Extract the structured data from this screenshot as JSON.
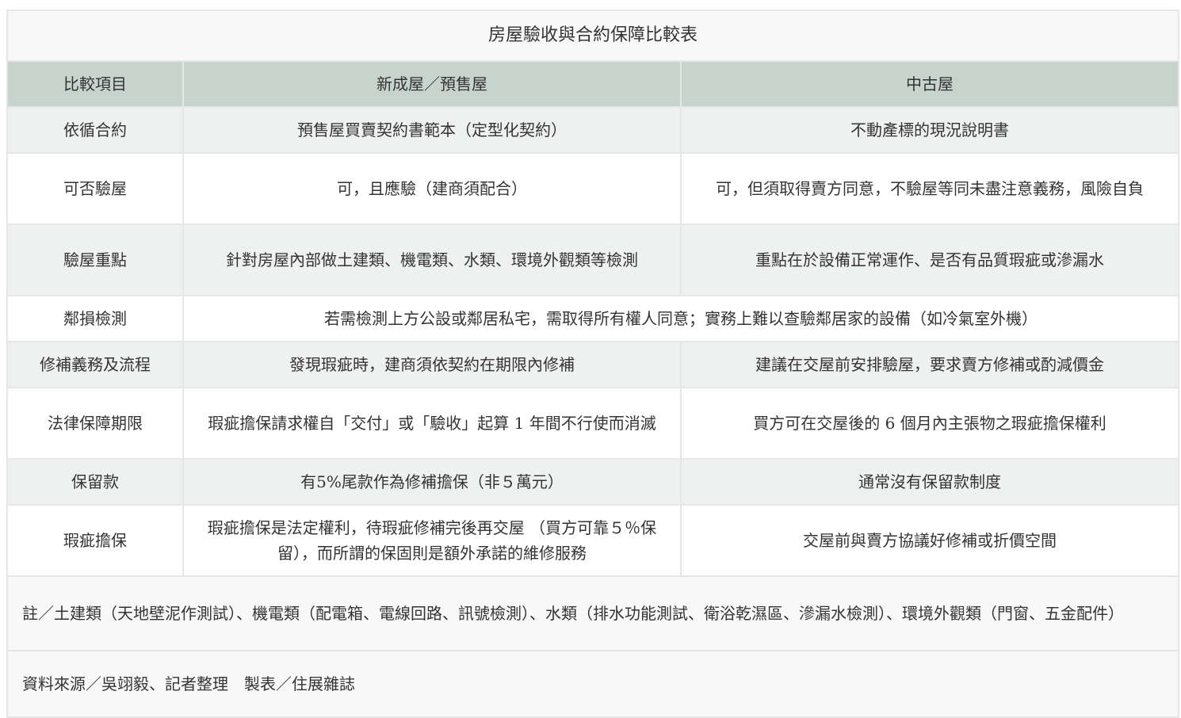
{
  "table": {
    "title": "房屋驗收與合約保障比較表",
    "headers": [
      "比較項目",
      "新成屋／預售屋",
      "中古屋"
    ],
    "rows": [
      [
        "依循合約",
        "預售屋買賣契約書範本（定型化契約）",
        "不動產標的現況說明書"
      ],
      [
        "可否驗屋",
        "可，且應驗（建商須配合）",
        "可，但須取得賣方同意，不驗屋等同未盡注意義務，風險自負"
      ],
      [
        "驗屋重點",
        "針對房屋內部做土建類、機電類、水類、環境外觀類等檢測",
        "重點在於設備正常運作、是否有品質瑕疵或滲漏水"
      ],
      [
        "鄰損檢測",
        "若需檢測上方公設或鄰居私宅，需取得所有權人同意；實務上難以查驗鄰居家的設備（如冷氣室外機）"
      ],
      [
        "修補義務及流程",
        "發現瑕疵時，建商須依契約在期限內修補",
        "建議在交屋前安排驗屋，要求賣方修補或酌減價金"
      ],
      [
        "法律保障期限",
        "瑕疵擔保請求權自「交付」或「驗收」起算 1 年間不行使而消滅",
        "買方可在交屋後的 6 個月內主張物之瑕疵擔保權利"
      ],
      [
        "保留款",
        "有5%尾款作為修補擔保（非５萬元）",
        "通常沒有保留款制度"
      ],
      [
        "瑕疵擔保",
        "瑕疵擔保是法定權利，待瑕疵修補完後再交屋 （買方可靠５％保留），而所謂的保固則是額外承諾的維修服務",
        "交屋前與賣方協議好修補或折價空間"
      ]
    ],
    "note": "註／土建類（天地壁泥作測試）、機電類（配電箱、電線回路、訊號檢測）、水類（排水功能測試、衛浴乾濕區、滲漏水檢測）、環境外觀類（門窗、五金配件）",
    "source": "資料來源／吳翊毅、記者整理　製表／住展雜誌"
  }
}
